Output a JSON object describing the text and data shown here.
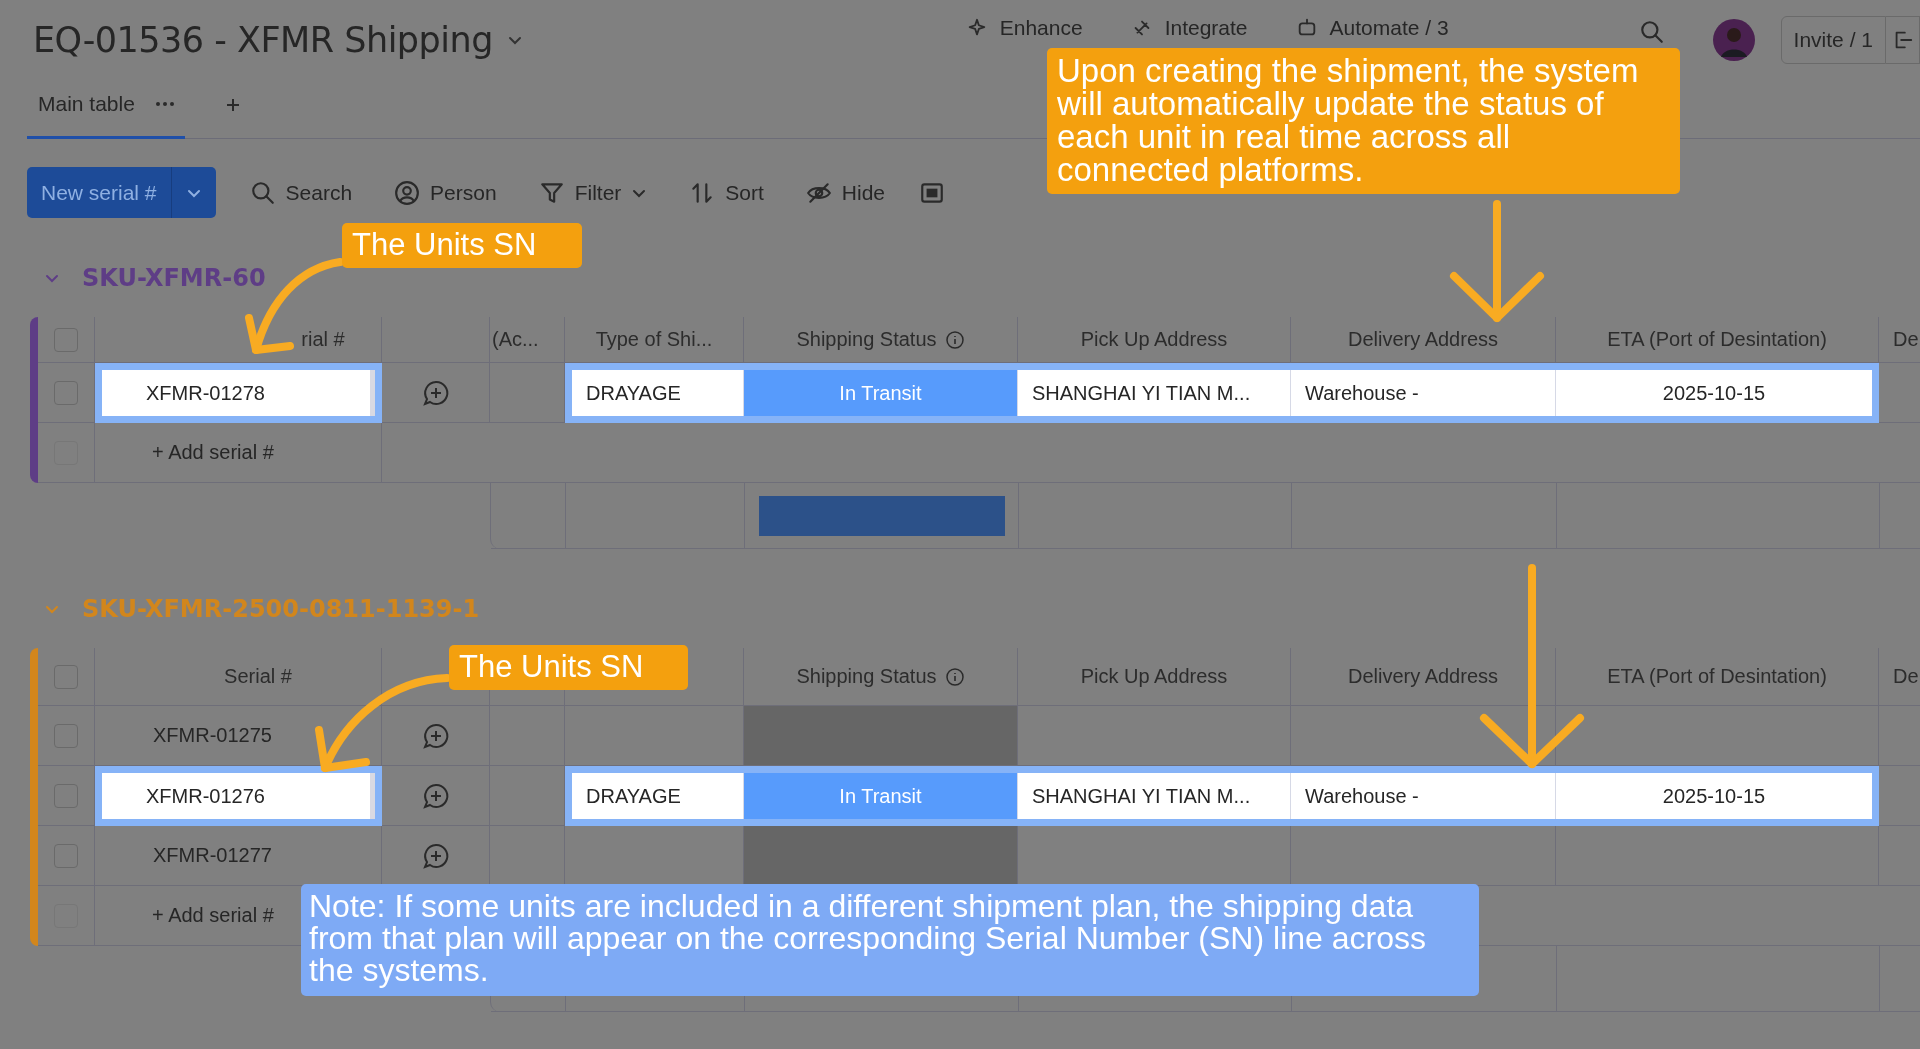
{
  "board": {
    "title": "EQ-01536 - XFMR Shipping"
  },
  "header_actions": [
    {
      "kind": "enhance",
      "label": "Enhance"
    },
    {
      "kind": "integrate",
      "label": "Integrate"
    },
    {
      "kind": "automate",
      "label": "Automate / 3"
    }
  ],
  "invite_button": "Invite / 1",
  "tabs": [
    {
      "label": "Main table",
      "selected": true
    }
  ],
  "toolbar": {
    "new_button": "New serial #",
    "items": [
      {
        "kind": "search",
        "label": "Search"
      },
      {
        "kind": "person",
        "label": "Person"
      },
      {
        "kind": "filter",
        "label": "Filter"
      },
      {
        "kind": "sort",
        "label": "Sort"
      },
      {
        "kind": "hide",
        "label": "Hide"
      },
      {
        "kind": "panel"
      }
    ]
  },
  "groups": [
    {
      "title": "SKU-XFMR-60",
      "color": "#5e3d86",
      "select_all": false,
      "summary_bar": true,
      "add_row": {
        "label": "+ Add serial #",
        "checked": false
      },
      "columns": [
        {
          "kind": "serial",
          "label": "rial #"
        },
        {
          "kind": "ac",
          "label": "(Ac..."
        },
        {
          "kind": "type",
          "label": "Type of Shi..."
        },
        {
          "kind": "status",
          "label": "Shipping Status"
        },
        {
          "kind": "pickup",
          "label": "Pick Up Address"
        },
        {
          "kind": "delivery",
          "label": "Delivery Address"
        },
        {
          "kind": "eta",
          "label": "ETA (Port of Desintation)"
        },
        {
          "kind": "next",
          "label": "De"
        }
      ],
      "rows": [
        {
          "serial": "XFMR-01278",
          "checked": false,
          "highlighted": true,
          "type": "DRAYAGE",
          "status": {
            "label": "In Transit",
            "color": "#579bfc"
          },
          "pickup": "SHANGHAI YI TIAN M...",
          "delivery": "Warehouse -",
          "eta": "2025-10-15"
        }
      ]
    },
    {
      "title": "SKU-XFMR-2500-0811-1139-1",
      "color": "#d2861c",
      "select_all": false,
      "add_row": {
        "label": "+ Add serial #",
        "checked": false
      },
      "columns": [
        {
          "kind": "serial",
          "label": "Serial #"
        },
        {
          "kind": "status",
          "label": "Shipping Status"
        },
        {
          "kind": "pickup",
          "label": "Pick Up Address"
        },
        {
          "kind": "delivery",
          "label": "Delivery Address"
        },
        {
          "kind": "eta",
          "label": "ETA (Port of Desintation)"
        },
        {
          "kind": "next",
          "label": "De"
        }
      ],
      "rows": [
        {
          "serial": "XFMR-01275",
          "checked": false,
          "highlighted": false,
          "status": {
            "color": "#666666"
          }
        },
        {
          "serial": "XFMR-01276",
          "checked": false,
          "highlighted": true,
          "type": "DRAYAGE",
          "status": {
            "label": "In Transit",
            "color": "#579bfc"
          },
          "pickup": "SHANGHAI YI TIAN M...",
          "delivery": "Warehouse -",
          "eta": "2025-10-15"
        },
        {
          "serial": "XFMR-01277",
          "checked": false,
          "highlighted": false,
          "status": {
            "color": "#666666"
          }
        }
      ]
    }
  ],
  "annotations": [
    {
      "kind": "callout",
      "text": "Upon creating the shipment, the system will automatically update the status of each unit in real time across all connected platforms."
    },
    {
      "kind": "callout",
      "text": "The Units SN"
    },
    {
      "kind": "callout",
      "text": "The Units SN"
    },
    {
      "kind": "note",
      "text": "Note: If some units are included in a different shipment plan, the shipping data from that plan will appear on the corresponding Serial Number (SN) line across the systems."
    }
  ]
}
